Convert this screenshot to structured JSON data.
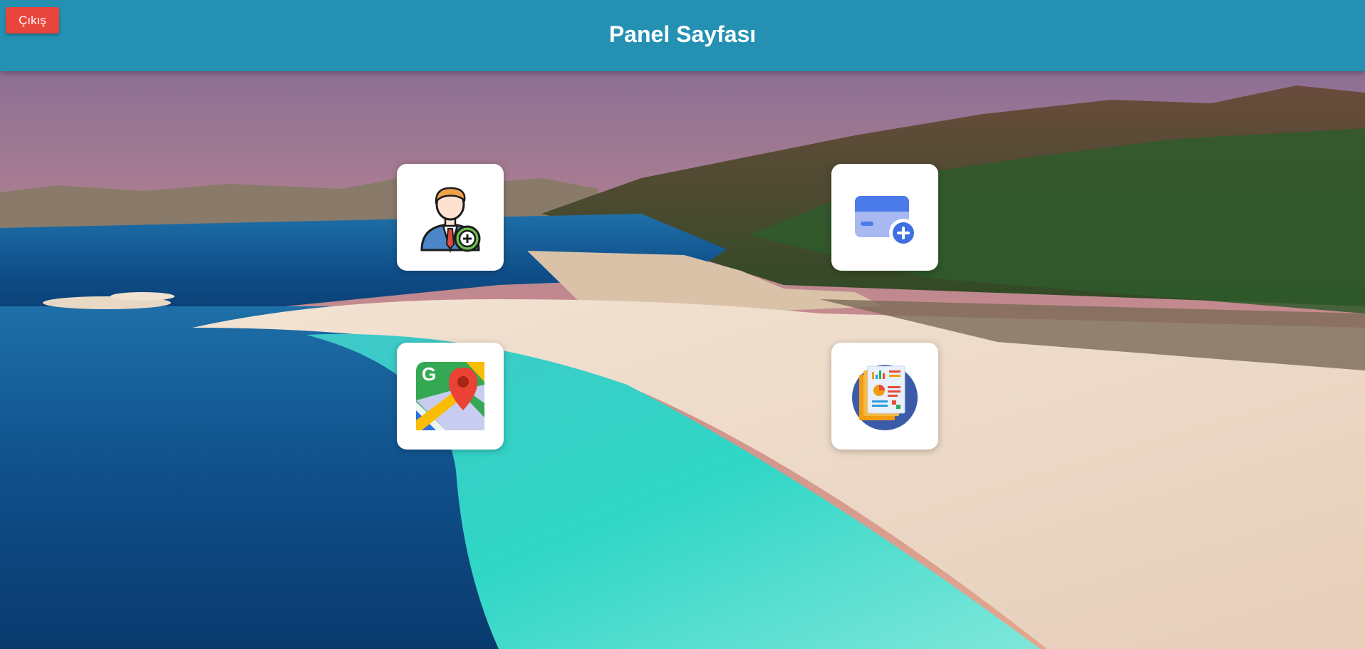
{
  "header": {
    "title": "Panel Sayfası",
    "logout_label": "Çıkış"
  },
  "colors": {
    "header_bg": "#2491b3",
    "logout_bg": "#e9453d",
    "tile_bg": "#ffffff"
  },
  "tiles": [
    {
      "icon": "add-user-icon"
    },
    {
      "icon": "add-card-icon"
    },
    {
      "icon": "google-maps-icon"
    },
    {
      "icon": "report-icon"
    }
  ]
}
